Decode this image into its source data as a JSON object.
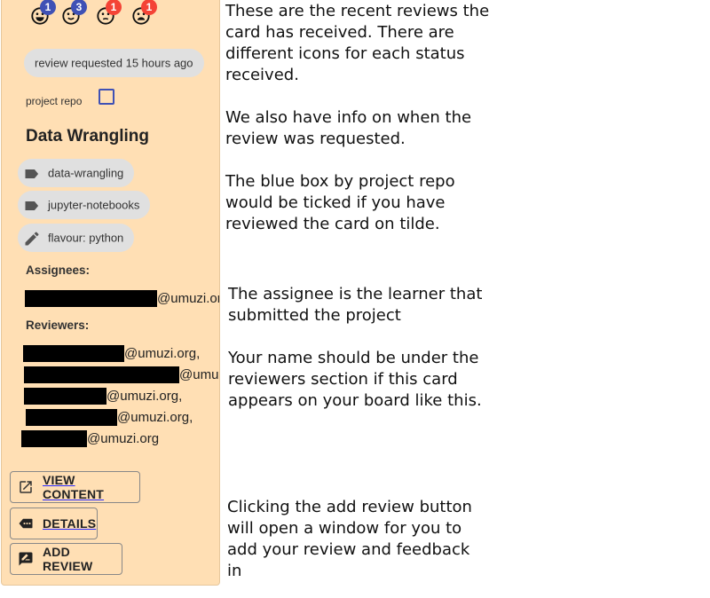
{
  "card": {
    "review_counts": [
      {
        "icon": "very-satisfied-face-icon",
        "count": "1",
        "color": "#3f51b5"
      },
      {
        "icon": "satisfied-face-icon",
        "count": "3",
        "color": "#3f51b5"
      },
      {
        "icon": "neutral-face-icon",
        "count": "1",
        "color": "#f44336"
      },
      {
        "icon": "dissatisfied-face-icon",
        "count": "1",
        "color": "#f44336"
      }
    ],
    "review_requested": "review requested 15 hours ago",
    "project_repo_label": "project repo",
    "project_repo_checked": false,
    "title": "Data Wrangling",
    "tags": [
      {
        "icon": "label-icon",
        "label": "data-wrangling"
      },
      {
        "icon": "label-icon",
        "label": "jupyter-notebooks"
      },
      {
        "icon": "pencil-icon",
        "label": "flavour: python"
      }
    ],
    "assignees_label": "Assignees:",
    "assignees": [
      "@umuzi.org"
    ],
    "reviewers_label": "Reviewers:",
    "reviewers": [
      "@umuzi.org,",
      "@umuzi.org,",
      "@umuzi.org,",
      "@umuzi.org,",
      "@umuzi.org"
    ],
    "buttons": {
      "view_content": "VIEW CONTENT",
      "details": "DETAILS",
      "add_review": "ADD REVIEW"
    },
    "colors": {
      "background": "#ffdfb4",
      "checkbox": "#3f51b5",
      "chip": "#e0e0e0"
    }
  },
  "notes": [
    "These are the recent reviews the\ncard has received. There are\ndifferent icons for each status\nreceived.\n\nWe also have info on when the\nreview was requested.\n\nThe blue box by project repo\nwould be ticked if you have\nreviewed the card on tilde.",
    "The assignee is the learner that\nsubmitted the project\n\nYour name should be under the\nreviewers section if this card\nappears on your board like this.",
    "Clicking the add review button\nwill open a window for you to\nadd your review and feedback\nin"
  ]
}
